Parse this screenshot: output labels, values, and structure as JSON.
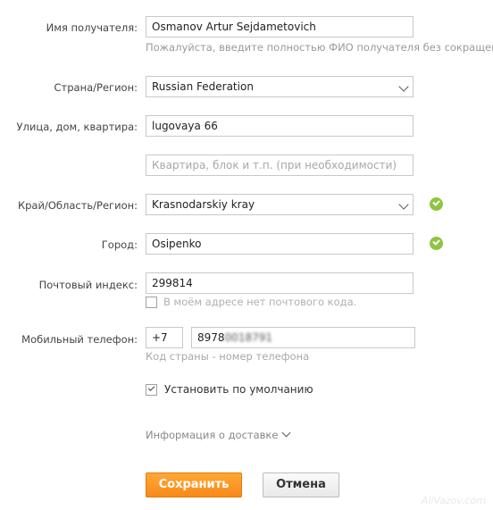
{
  "form": {
    "recipient_name": {
      "label": "Имя получателя:",
      "value": "Osmanov Artur  Sejdametovich",
      "hint": "Пожалуйста, введите полностью ФИО получателя без сокращений"
    },
    "country": {
      "label": "Страна/Регион:",
      "value": "Russian Federation"
    },
    "street": {
      "label": "Улица, дом, квартира:",
      "value": "lugovaya 66",
      "extra_placeholder": "Квартира, блок и т.п. (при необходимости)"
    },
    "region": {
      "label": "Край/Область/Регион:",
      "value": "Krasnodarskiy kray",
      "status": "valid"
    },
    "city": {
      "label": "Город:",
      "value": "Osipenko",
      "status": "valid"
    },
    "postal_code": {
      "label": "Почтовый индекс:",
      "value": "299814",
      "no_code_label": "В моём адресе нет почтового кода.",
      "no_code_checked": false
    },
    "phone": {
      "label": "Мобильный телефон:",
      "country_code": "+7",
      "number_visible": "8978",
      "number_blurred": "0018791",
      "hint": "Код страны - номер телефона"
    },
    "default": {
      "label": "Установить по умолчанию",
      "checked": true
    },
    "delivery_info": {
      "label": "Информация о доставке"
    },
    "buttons": {
      "save": "Сохранить",
      "cancel": "Отмена"
    }
  },
  "watermark": "AliVazov.com",
  "colors": {
    "accent_orange": "#f7891a",
    "valid_green": "#8cc63f"
  },
  "icons": {
    "dropdown": "chevron-down-icon",
    "valid": "check-circle-icon",
    "expand": "chevron-down-icon"
  }
}
